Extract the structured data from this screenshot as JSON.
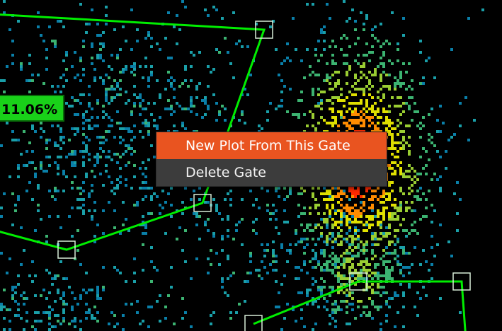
{
  "plot": {
    "gate_percentage": "11.06%",
    "gate_color": "#00ee00",
    "handle_color": "#d8eed8",
    "density_colors": [
      "#0a7fa8",
      "#1a9fa8",
      "#3cb371",
      "#9acd32",
      "#e0e000",
      "#ff8c00",
      "#ff2a00"
    ]
  },
  "context_menu": {
    "items": [
      {
        "label": "New Plot From This Gate",
        "highlighted": true
      },
      {
        "label": "Delete Gate",
        "highlighted": false
      }
    ],
    "highlight_color": "#e95420"
  }
}
